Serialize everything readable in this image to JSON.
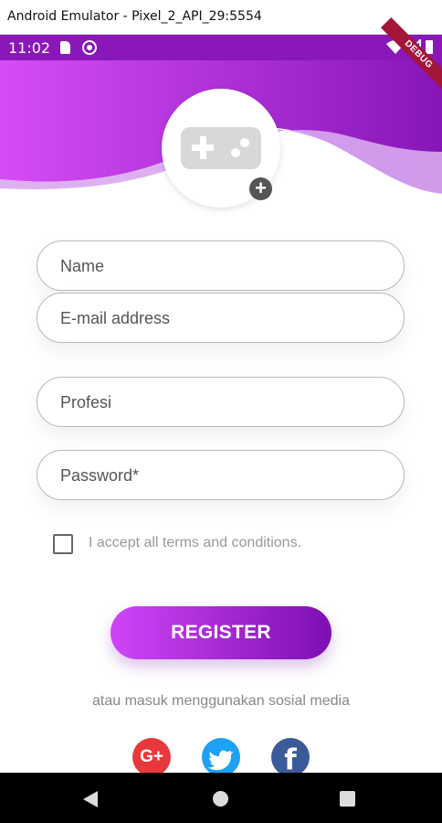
{
  "window": {
    "title": "Android Emulator - Pixel_2_API_29:5554"
  },
  "status_bar": {
    "time": "11:02"
  },
  "debug_banner": "DEBUG",
  "form": {
    "name_placeholder": "Name",
    "email_placeholder": "E-mail address",
    "profession_placeholder": "Profesi",
    "password_placeholder": "Password*",
    "terms_label": "I accept all terms and conditions.",
    "terms_checked": false
  },
  "actions": {
    "register_label": "REGISTER"
  },
  "social": {
    "caption": "atau masuk menggunakan sosial media",
    "google_label": "G+",
    "facebook_label": "f"
  },
  "colors": {
    "primary_purple": "#8a18b8",
    "gradient_start": "#cf45f6",
    "gradient_end": "#7d0fb3",
    "google_red": "#e9383d",
    "twitter_blue": "#1da1f2",
    "facebook_blue": "#3b5a9a"
  },
  "icons": {
    "avatar": "gamepad-icon",
    "add": "plus-icon",
    "nav_back": "back-triangle-icon",
    "nav_home": "home-circle-icon",
    "nav_recent": "recents-square-icon"
  }
}
